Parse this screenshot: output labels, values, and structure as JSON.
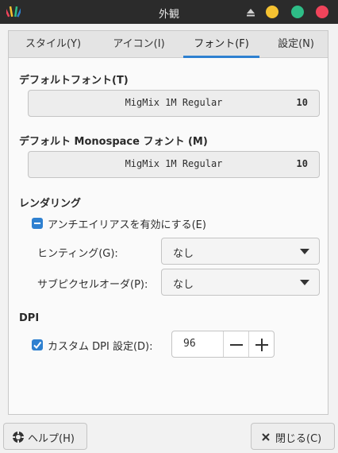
{
  "window": {
    "title": "外観"
  },
  "tabs": [
    {
      "label": "スタイル(Y)",
      "active": false
    },
    {
      "label": "アイコン(I)",
      "active": false
    },
    {
      "label": "フォント(F)",
      "active": true
    },
    {
      "label": "設定(N)",
      "active": false
    }
  ],
  "default_font": {
    "heading": "デフォルトフォント(T)",
    "name": "MigMix 1M Regular",
    "size": "10"
  },
  "mono_font": {
    "heading": "デフォルト Monospace フォント (M)",
    "name": "MigMix 1M Regular",
    "size": "10"
  },
  "rendering": {
    "heading": "レンダリング",
    "antialias_label": "アンチエイリアスを有効にする(E)",
    "antialias_state": "mixed",
    "hinting_label": "ヒンティング(G):",
    "hinting_value": "なし",
    "subpixel_label": "サブピクセルオーダ(P):",
    "subpixel_value": "なし"
  },
  "dpi": {
    "heading": "DPI",
    "custom_label": "カスタム DPI 設定(D):",
    "custom_checked": true,
    "value": "96"
  },
  "footer": {
    "help_label": "ヘルプ(H)",
    "close_label": "閉じる(C)"
  },
  "colors": {
    "accent": "#2e80d0",
    "titlebar": "#2b2b2b",
    "minimize": "#f5c231",
    "maximize": "#2ebd87",
    "close": "#f0445b"
  }
}
